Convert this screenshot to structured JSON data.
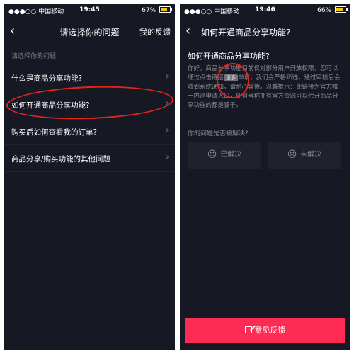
{
  "left": {
    "status": {
      "carrier": "●●●○○ 中国移动",
      "time": "19:45",
      "battery": "67%",
      "battery_level": 0.67
    },
    "nav": {
      "back_icon": "chevron-left-icon",
      "title": "请选择你的问题",
      "action": "我的反馈"
    },
    "section_label": "请选择你的问题",
    "questions": [
      {
        "label": "什么是商品分享功能?"
      },
      {
        "label": "如何开通商品分享功能?"
      },
      {
        "label": "购买后如何查看我的订单?"
      },
      {
        "label": "商品分享/购买功能的其他问题"
      }
    ]
  },
  "right": {
    "status": {
      "carrier": "●●●○○ 中国移动",
      "time": "19:46",
      "battery": "66%",
      "battery_level": 0.66
    },
    "nav": {
      "back_icon": "chevron-left-icon",
      "title": "如何开通商品分享功能?"
    },
    "article": {
      "title": "如何开通商品分享功能?",
      "body_start": "你好，商品分享功能目前仅对部分用户开放权限，您可以通过点击链接",
      "more_badge": "更多",
      "body_end": "申请，我们会严格筛选，通过审核后会收到系统通知，请耐心等待。温馨提示：此链接为官方唯一内测申请入口，任何号称拥有官方资源可以代开商品分享功能的都是骗子。"
    },
    "solved_question": "你的问题是否被解决?",
    "solved_button": "已解决",
    "unsolved_button": "未解决",
    "feedback_button": "意见反馈"
  },
  "colors": {
    "background": "#161823",
    "accent": "#fe2c55",
    "annotation": "#e0241e"
  }
}
